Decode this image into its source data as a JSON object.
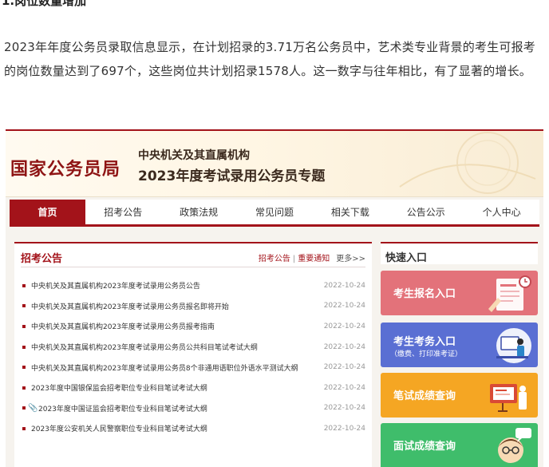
{
  "article": {
    "heading": "1.岗位数量增加",
    "paragraph": "2023年年度公务员录取信息显示，在计划招录的3.71万名公务员中，艺术类专业背景的考生可报考的岗位数量达到了697个，这些岗位共计划招录1578人。这一数字与往年相比，有了显著的增长。"
  },
  "screenshot": {
    "banner": {
      "agency": "国家公务员局",
      "subtitle_1": "中央机关及其直属机构",
      "subtitle_2": "2023年度考试录用公务员专题"
    },
    "nav": [
      {
        "label": "首页",
        "active": true
      },
      {
        "label": "招考公告"
      },
      {
        "label": "政策法规"
      },
      {
        "label": "常见问题"
      },
      {
        "label": "相关下载"
      },
      {
        "label": "公告公示"
      },
      {
        "label": "个人中心"
      }
    ],
    "notices": {
      "title": "招考公告",
      "link_1": "招考公告",
      "link_sep": "|",
      "link_2": "重要通知",
      "more": "更多>>",
      "items": [
        {
          "title": "中央机关及其直属机构2023年度考试录用公务员公告",
          "date": "2022-10-24"
        },
        {
          "title": "中央机关及其直属机构2023年度考试录用公务员报名即将开始",
          "date": "2022-10-24"
        },
        {
          "title": "中央机关及其直属机构2023年度考试录用公务员报考指南",
          "date": "2022-10-24"
        },
        {
          "title": "中央机关及其直属机构2023年度考试录用公务员公共科目笔试考试大纲",
          "date": "2022-10-24"
        },
        {
          "title": "中央机关及其直属机构2023年度考试录用公务员8个非通用语职位外语水平测试大纲",
          "date": "2022-10-24"
        },
        {
          "title": "2023年度中国银保监会招考职位专业科目笔试考试大纲",
          "date": "2022-10-24"
        },
        {
          "title": "2023年度中国证监会招考职位专业科目笔试考试大纲",
          "date": "2022-10-24",
          "attachment_icon": "paperclip-icon"
        },
        {
          "title": "2023年度公安机关人民警察职位专业科目笔试考试大纲",
          "date": "2022-10-24"
        }
      ]
    },
    "quick": {
      "title": "快速入口",
      "cards": [
        {
          "label": "考生报名入口",
          "color": "#e3727a",
          "icon": "registration-form-icon"
        },
        {
          "label": "考生考务入口",
          "sub": "（缴费、打印准考证）",
          "color": "#5a6fd3",
          "icon": "candidate-at-desk-icon"
        },
        {
          "label": "笔试成绩查询",
          "color": "#f5a623",
          "icon": "exam-score-board-icon"
        },
        {
          "label": "面试成绩查询",
          "color": "#3fbd6b",
          "icon": "interview-person-icon"
        }
      ]
    },
    "colors": {
      "brand_red": "#a3131a",
      "date_gray": "#999999"
    }
  }
}
